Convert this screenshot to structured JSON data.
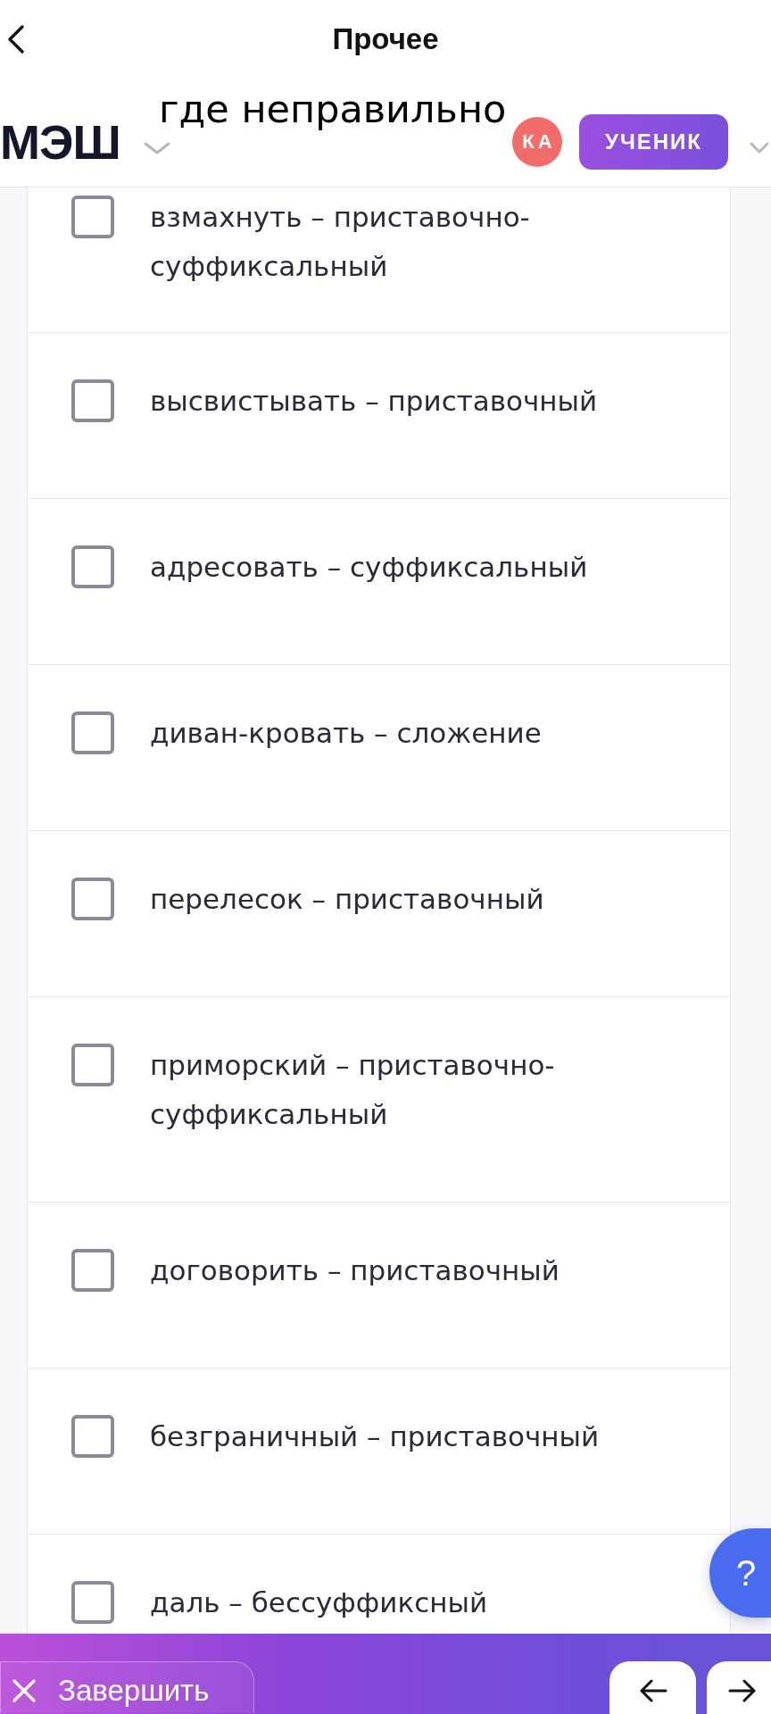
{
  "nav": {
    "title": "Прочее"
  },
  "annotation": "где неправильно",
  "header": {
    "logo": "МЭШ",
    "avatar_initials": "КА",
    "role_button": "УЧЕНИК"
  },
  "options": [
    {
      "text": "взмахнуть – приставочно-суффиксальный",
      "checked": false
    },
    {
      "text": "высвистывать – приставочный",
      "checked": false
    },
    {
      "text": "адресовать – суффиксальный",
      "checked": false
    },
    {
      "text": "диван-кровать – сложение",
      "checked": false
    },
    {
      "text": "перелесок – приставочный",
      "checked": false
    },
    {
      "text": "приморский – приставочно-суффиксальный",
      "checked": false
    },
    {
      "text": "договорить – приставочный",
      "checked": false
    },
    {
      "text": "безграничный – приставочный",
      "checked": false
    },
    {
      "text": "даль – бессуффиксный",
      "checked": false
    }
  ],
  "help_button": "?",
  "bottom_bar": {
    "finish_button": "Завершить"
  }
}
